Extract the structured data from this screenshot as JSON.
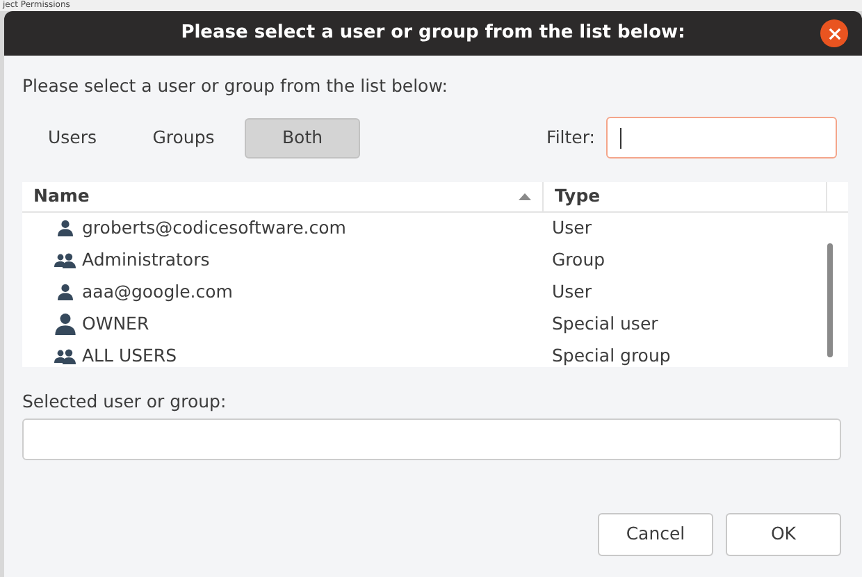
{
  "background_window": {
    "title": "ject Permissions"
  },
  "dialog": {
    "title": "Please select a user or group from the list below:",
    "prompt": "Please select a user or group from the list below:"
  },
  "tabs": [
    {
      "label": "Users",
      "selected": false
    },
    {
      "label": "Groups",
      "selected": false
    },
    {
      "label": "Both",
      "selected": true
    }
  ],
  "filter": {
    "label": "Filter:"
  },
  "table": {
    "columns": [
      {
        "label": "Name",
        "sorted": true
      },
      {
        "label": "Type",
        "sorted": false
      }
    ],
    "rows": [
      {
        "kind": "user",
        "name": "groberts@codicesoftware.com",
        "type": "User"
      },
      {
        "kind": "group",
        "name": "Administrators",
        "type": "Group"
      },
      {
        "kind": "user",
        "name": "aaa@google.com",
        "type": "User"
      },
      {
        "kind": "special_user",
        "name": "OWNER",
        "type": "Special user"
      },
      {
        "kind": "group",
        "name": "ALL USERS",
        "type": "Special group"
      }
    ]
  },
  "selected_field": {
    "label": "Selected user or group:"
  },
  "buttons": [
    "Cancel",
    "OK"
  ]
}
